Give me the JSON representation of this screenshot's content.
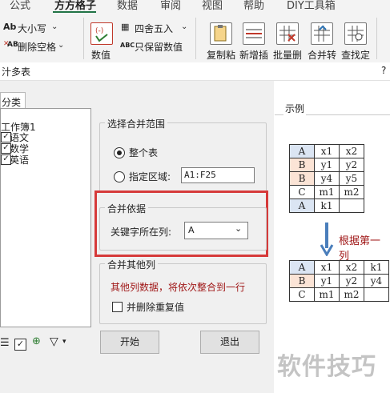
{
  "ribbon": {
    "tabs": [
      "公式",
      "方方格子",
      "数据",
      "审阅",
      "视图",
      "帮助",
      "DIY工具箱"
    ],
    "case_btn": {
      "icon": "Ab",
      "label": "大小写"
    },
    "remove_space_btn": {
      "icon": "AB",
      "label": "删除空格"
    },
    "value_btn": "数值",
    "round_btn": "四舍五入",
    "keep_value_btn": "只保留数值",
    "copy_paste": "复制粘",
    "new_add": "新增插",
    "batch_delete": "批量删",
    "merge_convert": "合并转",
    "find_locate": "查找定"
  },
  "dialog": {
    "title": "汁多表",
    "help": "?",
    "tab_label": "分类",
    "tree": {
      "root": "工作簿1",
      "items": [
        "语文",
        "数学",
        "英语"
      ]
    },
    "range_group": {
      "title": "选择合并范围",
      "whole_table": "整个表",
      "specific_range": "指定区域:",
      "range_value": "A1:F25"
    },
    "basis_group": {
      "title": "合并依据",
      "key_col_label": "关键字所在列:",
      "key_col_value": "A"
    },
    "other_group": {
      "title": "合并其他列",
      "note": "其他列数据，将依次整合到一行",
      "dedupe": "并删除重复值"
    },
    "start_btn": "开始",
    "exit_btn": "退出",
    "example": {
      "title": "示例",
      "caption": "根据第一列",
      "watermark": "软件技巧",
      "before": [
        [
          "A",
          "x1",
          "x2"
        ],
        [
          "B",
          "y1",
          "y2"
        ],
        [
          "B",
          "y4",
          "y5"
        ],
        [
          "C",
          "m1",
          "m2"
        ],
        [
          "A",
          "k1",
          ""
        ]
      ],
      "after": [
        [
          "A",
          "x1",
          "x2",
          "k1"
        ],
        [
          "B",
          "y1",
          "y2",
          "y4"
        ],
        [
          "C",
          "m1",
          "m2",
          ""
        ]
      ]
    },
    "colors": {
      "highlight": "#d63a3a",
      "accent_blue": "#4a7ebb",
      "note_red": "#a01818"
    }
  }
}
